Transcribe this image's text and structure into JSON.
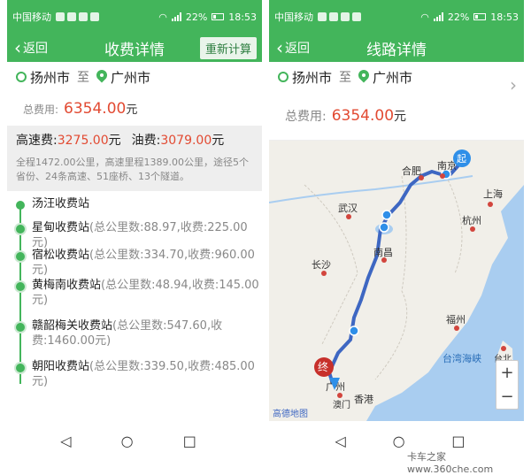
{
  "status": {
    "carrier": "中国移动",
    "signal_label": "3G",
    "battery": "22%",
    "time": "18:53"
  },
  "left": {
    "nav": {
      "back": "返回",
      "title": "收费详情",
      "action": "重新计算"
    },
    "route": {
      "from": "扬州市",
      "to_word": "至",
      "to": "广州市"
    },
    "total": {
      "label": "总费用:",
      "value": "6354.00",
      "unit": "元"
    },
    "fees": {
      "highway_label": "高速费:",
      "highway_value": "3275.00",
      "highway_unit": "元",
      "fuel_label": "油费:",
      "fuel_value": "3079.00",
      "fuel_unit": "元",
      "desc": "全程1472.00公里，高速里程1389.00公里，途径5个省份、24条高速、51座桥、13个隧道。"
    },
    "stations": [
      {
        "name": "汤汪收费站",
        "meta": ""
      },
      {
        "name": "星甸收费站",
        "meta": "(总公里数:88.97,收费:225.00元)"
      },
      {
        "name": "宿松收费站",
        "meta": "(总公里数:334.70,收费:960.00元)"
      },
      {
        "name": "黄梅南收费站",
        "meta": "(总公里数:48.94,收费:145.00元)"
      },
      {
        "name": "赣韶梅关收费站",
        "meta": "(总公里数:547.60,收费:1460.00元)"
      },
      {
        "name": "朝阳收费站",
        "meta": "(总公里数:339.50,收费:485.00元)"
      }
    ]
  },
  "right": {
    "nav": {
      "back": "返回",
      "title": "线路详情"
    },
    "route": {
      "from": "扬州市",
      "to_word": "至",
      "to": "广州市"
    },
    "total": {
      "label": "总费用:",
      "value": "6354.00",
      "unit": "元"
    },
    "map": {
      "cities": [
        "合肥",
        "南京",
        "上海",
        "武汉",
        "杭州",
        "长沙",
        "南昌",
        "福州",
        "台湾海峡",
        "台北",
        "广州",
        "香港",
        "澳门"
      ],
      "start_marker": "起",
      "end_marker": "终",
      "brand": "高德地图",
      "zoom_in": "+",
      "zoom_out": "−"
    }
  },
  "watermark": "卡车之家 www.360che.com"
}
